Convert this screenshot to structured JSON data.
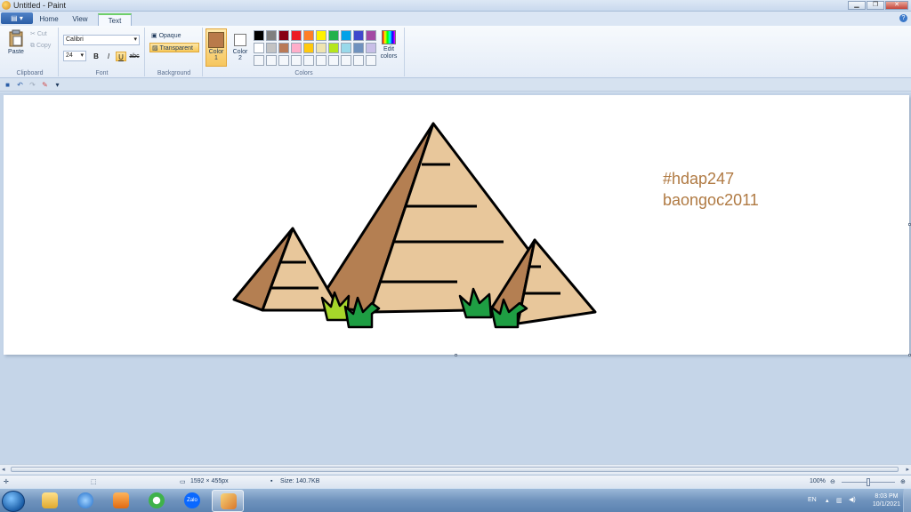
{
  "window": {
    "title": "Untitled - Paint"
  },
  "tabs": [
    {
      "label": "Home"
    },
    {
      "label": "View"
    },
    {
      "label": "Text"
    }
  ],
  "clipboard": {
    "paste": "Paste",
    "cut": "Cut",
    "copy": "Copy",
    "group_label": "Clipboard"
  },
  "font": {
    "family": "Calibri",
    "size": "24",
    "group_label": "Font",
    "bold": "B",
    "italic": "I",
    "underline": "U",
    "strike": "abc"
  },
  "background": {
    "opaque": "Opaque",
    "transparent": "Transparent",
    "group_label": "Background",
    "selected": "Transparent"
  },
  "colors": {
    "color1_label": "Color",
    "color1_num": "1",
    "color2_label": "Color",
    "color2_num": "2",
    "edit_colors": "Edit colors",
    "group_label": "Colors",
    "color1": "#b97a4a",
    "color2": "#ffffff",
    "palette_row1": [
      "#000000",
      "#7f7f7f",
      "#880015",
      "#ed1c24",
      "#ff7f27",
      "#fff200",
      "#22b14c",
      "#00a2e8",
      "#3f48cc",
      "#a349a4"
    ],
    "palette_row2": [
      "#ffffff",
      "#c3c3c3",
      "#b97a57",
      "#ffaec9",
      "#ffc90e",
      "#efe4b0",
      "#b5e61d",
      "#99d9ea",
      "#7092be",
      "#c8bfe7"
    ]
  },
  "canvas": {
    "text_line1": "#hdap247",
    "text_line2": "baongoc2011",
    "drawing_colors": {
      "stroke": "#000000",
      "light": "#e8c79b",
      "dark": "#b47f52",
      "grass_light": "#a6d62a",
      "grass_dark": "#1e9e43"
    }
  },
  "status": {
    "dimensions": "1592 × 455px",
    "size": "Size: 140.7KB",
    "zoom": "100%"
  },
  "taskbar": {
    "apps": [
      "explorer-icon",
      "internet-explorer-icon",
      "media-player-icon",
      "coccoc-browser-icon",
      "zalo-icon",
      "paint-icon"
    ],
    "zalo_label": "Zalo",
    "lang": "EN",
    "time": "8:03 PM",
    "date": "10/1/2021"
  }
}
